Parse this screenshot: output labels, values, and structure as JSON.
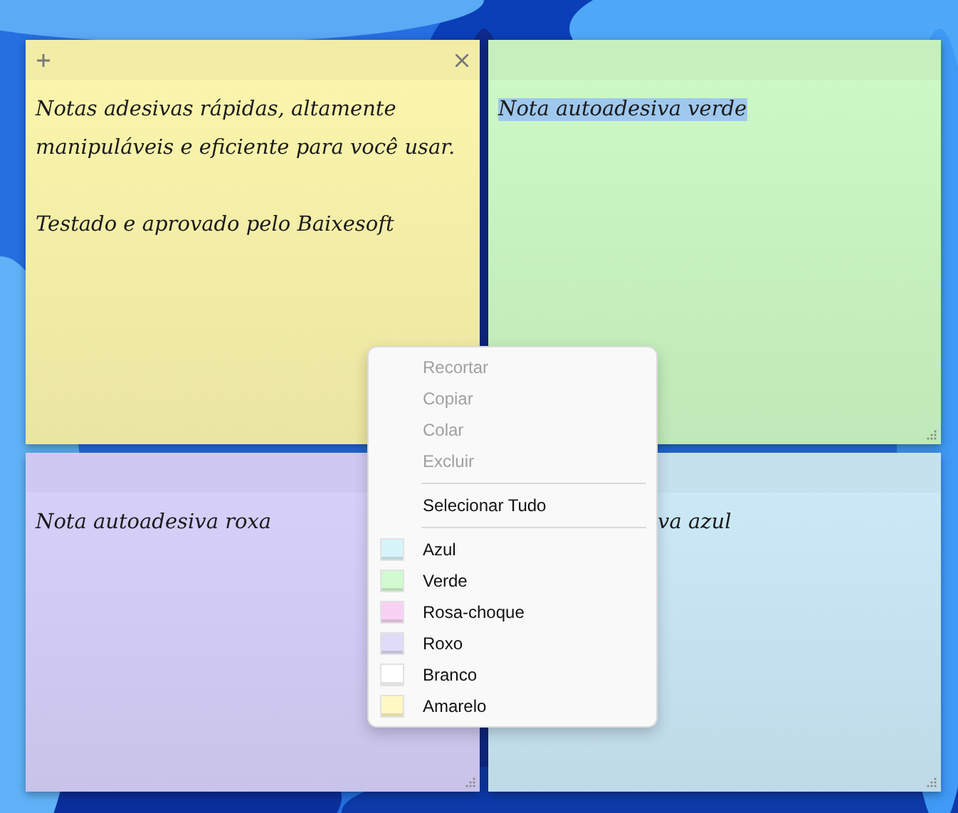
{
  "notes": [
    {
      "color": "#fcf6ad",
      "active": true,
      "text_selected": false,
      "paragraphs": [
        "Notas adesivas rápidas, altamente manipuláveis e eficiente para você usar.",
        "Testado e aprovado pelo Baixesoft"
      ]
    },
    {
      "color": "#cdfac6",
      "active": false,
      "text_selected": true,
      "resize_grip": true,
      "paragraphs": [
        "Nota autoadesiva verde"
      ]
    },
    {
      "color": "#d8d1fb",
      "active": false,
      "text_selected": false,
      "resize_grip": true,
      "paragraphs": [
        "Nota autoadesiva roxa"
      ]
    },
    {
      "color": "#cdeaf8",
      "active": false,
      "text_selected": false,
      "resize_grip": true,
      "paragraphs": [
        "va azul"
      ]
    }
  ],
  "context_menu": {
    "items": [
      {
        "kind": "command",
        "label": "Recortar",
        "disabled": true
      },
      {
        "kind": "command",
        "label": "Copiar",
        "disabled": true
      },
      {
        "kind": "command",
        "label": "Colar",
        "disabled": true
      },
      {
        "kind": "command",
        "label": "Excluir",
        "disabled": true
      },
      {
        "kind": "separator"
      },
      {
        "kind": "command",
        "label": "Selecionar Tudo",
        "disabled": false
      },
      {
        "kind": "separator"
      },
      {
        "kind": "color",
        "label": "Azul",
        "color": "#d6f4fa"
      },
      {
        "kind": "color",
        "label": "Verde",
        "color": "#d1fad0"
      },
      {
        "kind": "color",
        "label": "Rosa-choque",
        "color": "#f8d2f4"
      },
      {
        "kind": "color",
        "label": "Roxo",
        "color": "#e0dbf6"
      },
      {
        "kind": "color",
        "label": "Branco",
        "color": "#ffffff"
      },
      {
        "kind": "color",
        "label": "Amarelo",
        "color": "#fdf8c4"
      }
    ]
  }
}
